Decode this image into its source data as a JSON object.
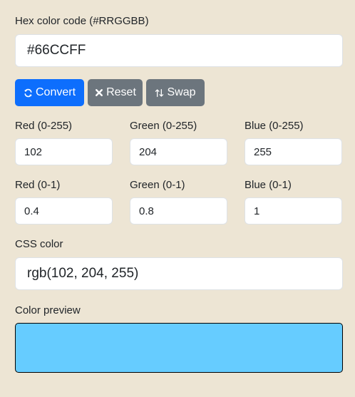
{
  "hex": {
    "label": "Hex color code (#RRGGBB)",
    "value": "#66CCFF"
  },
  "buttons": {
    "convert": {
      "label": "Convert",
      "icon": "sync-icon"
    },
    "reset": {
      "label": "Reset",
      "icon": "close-icon"
    },
    "swap": {
      "label": "Swap",
      "icon": "swap-vertical-icon"
    }
  },
  "rgb255": {
    "red": {
      "label": "Red (0-255)",
      "value": "102"
    },
    "green": {
      "label": "Green (0-255)",
      "value": "204"
    },
    "blue": {
      "label": "Blue (0-255)",
      "value": "255"
    }
  },
  "rgb01": {
    "red": {
      "label": "Red (0-1)",
      "value": "0.4"
    },
    "green": {
      "label": "Green (0-1)",
      "value": "0.8"
    },
    "blue": {
      "label": "Blue (0-1)",
      "value": "1"
    }
  },
  "css": {
    "label": "CSS color",
    "value": "rgb(102, 204, 255)"
  },
  "preview": {
    "label": "Color preview",
    "color": "#66CCFF"
  }
}
